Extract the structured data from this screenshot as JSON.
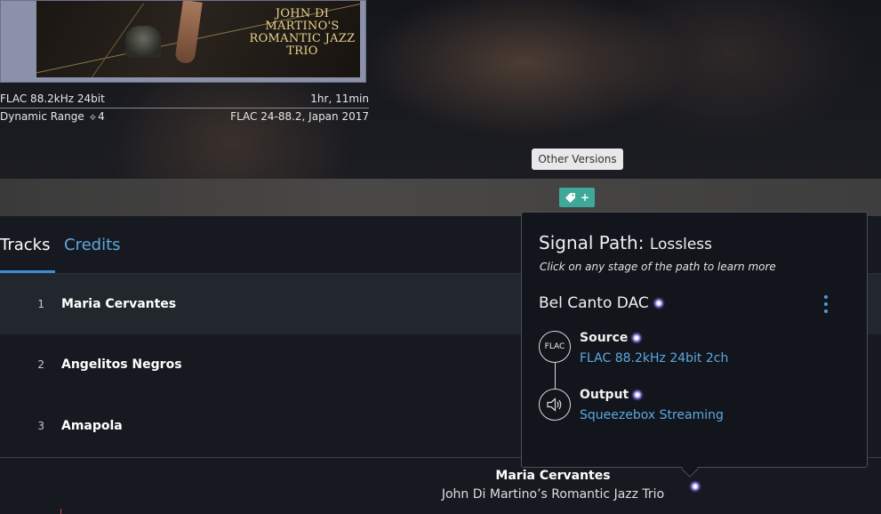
{
  "album": {
    "art_title": "JOHN DI MARTINO'S ROMANTIC JAZZ TRIO",
    "format": "FLAC 88.2kHz 24bit",
    "duration": "1hr, 11min",
    "dynamic_range_label": "Dynamic Range",
    "dynamic_range_value": "4",
    "edition": "FLAC 24-88.2, Japan 2017"
  },
  "other_versions_label": "Other Versions",
  "tag_button_label": "+",
  "tabs": {
    "tracks": "Tracks",
    "credits": "Credits"
  },
  "tracks": [
    {
      "number": "1",
      "title": "Maria Cervantes"
    },
    {
      "number": "2",
      "title": "Angelitos Negros"
    },
    {
      "number": "3",
      "title": "Amapola"
    }
  ],
  "now_playing": {
    "title": "Maria Cervantes",
    "artist": "John Di Martino’s Romantic Jazz Trio"
  },
  "signal_path": {
    "title": "Signal Path:",
    "quality": "Lossless",
    "hint": "Click on any stage of the path to learn more",
    "device": "Bel Canto DAC",
    "stages": [
      {
        "icon": "FLAC",
        "label": "Source",
        "value": "FLAC 88.2kHz 24bit 2ch"
      },
      {
        "icon": "speaker-icon",
        "label": "Output",
        "value": "Squeezebox Streaming"
      }
    ]
  },
  "colors": {
    "accent_blue": "#5ea7e0",
    "tag_teal": "#3ea89a",
    "quality_sparkle": "#b8a6ff"
  }
}
